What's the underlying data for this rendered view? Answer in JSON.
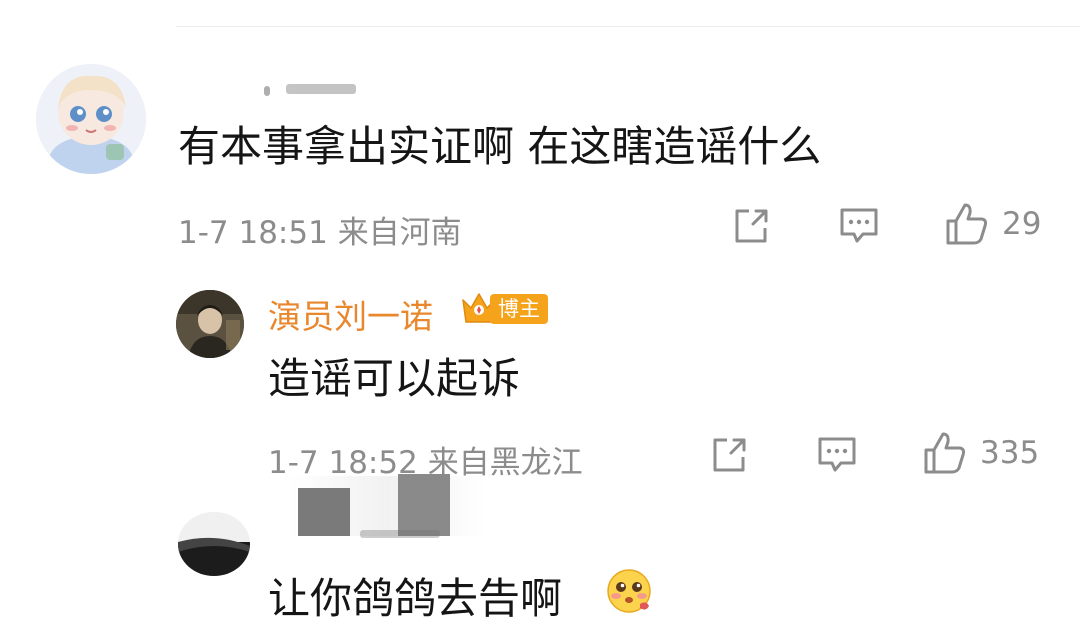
{
  "comments": [
    {
      "text": "有本事拿出实证啊 在这瞎造谣什么",
      "time": "1-7 18:51",
      "location": "来自河南",
      "likes": "29"
    },
    {
      "author": "演员刘一诺",
      "badge": "博主",
      "text": "造谣可以起诉",
      "time": "1-7 18:52",
      "location": "来自黑龙江",
      "likes": "335"
    },
    {
      "text": "让你鸽鸽去告啊",
      "emoji": "blush-pleading-emoji"
    }
  ],
  "icons": {
    "share": "share-icon",
    "comment": "comment-icon",
    "like": "thumbs-up-icon"
  },
  "colors": {
    "author_name": "#e8872b",
    "badge_bg": "#f6a31c",
    "meta_text": "#8c8c8c"
  }
}
